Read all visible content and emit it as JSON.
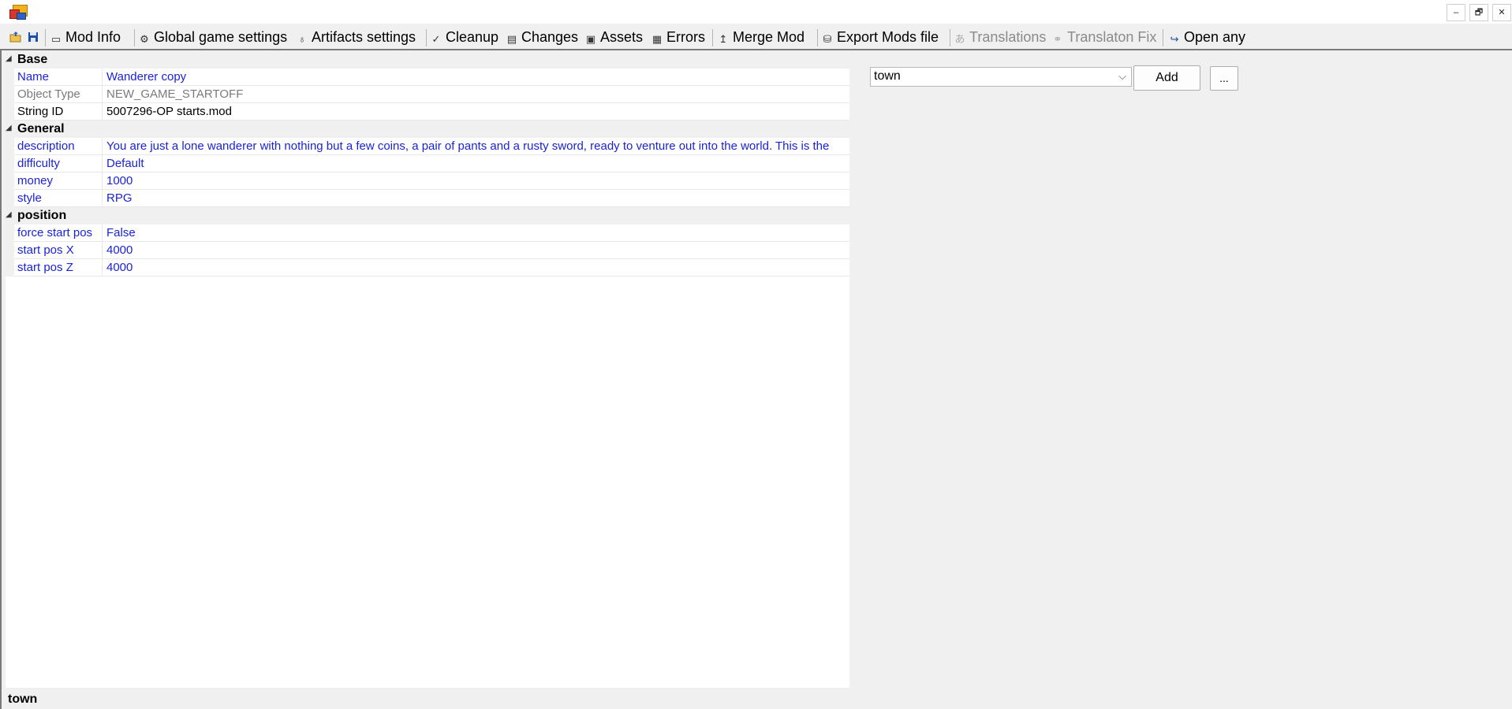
{
  "window": {
    "minimize": "–",
    "restore": "🗗",
    "close": "✕"
  },
  "toolbar": {
    "items": [
      {
        "label": "Mod Info",
        "icon": "mod-info-icon"
      },
      {
        "label": "Global game settings",
        "icon": "gear-icon"
      },
      {
        "label": "Artifacts settings",
        "icon": "artifact-icon"
      },
      {
        "label": "Cleanup",
        "icon": "broom-icon"
      },
      {
        "label": "Changes",
        "icon": "changes-icon"
      },
      {
        "label": "Assets",
        "icon": "assets-icon"
      },
      {
        "label": "Errors",
        "icon": "errors-icon"
      },
      {
        "label": "Merge Mod",
        "icon": "merge-icon"
      },
      {
        "label": "Export Mods file",
        "icon": "export-icon"
      },
      {
        "label": "Translations",
        "icon": "translations-icon",
        "disabled": true
      },
      {
        "label": "Translaton Fix",
        "icon": "translation-fix-icon",
        "disabled": true
      },
      {
        "label": "Open any",
        "icon": "open-arrow-icon"
      }
    ]
  },
  "grid": {
    "categories": [
      {
        "label": "Base",
        "rows": [
          {
            "name": "Name",
            "value": "Wanderer copy"
          },
          {
            "name": "Object Type",
            "value": "NEW_GAME_STARTOFF"
          },
          {
            "name": "String ID",
            "value": "5007296-OP starts.mod"
          }
        ]
      },
      {
        "label": "General",
        "rows": [
          {
            "name": "description",
            "value": "You are just a lone wanderer with nothing but a few coins, a pair of pants and a rusty sword, ready to venture out into the world.  This is the"
          },
          {
            "name": "difficulty",
            "value": "Default"
          },
          {
            "name": "money",
            "value": "1000"
          },
          {
            "name": "style",
            "value": "RPG"
          }
        ]
      },
      {
        "label": "position",
        "rows": [
          {
            "name": "force start pos",
            "value": "False"
          },
          {
            "name": "start pos X",
            "value": "4000"
          },
          {
            "name": "start pos Z",
            "value": "4000"
          }
        ]
      }
    ]
  },
  "side": {
    "combo_value": "town",
    "add_label": "Add",
    "more_label": "..."
  },
  "status": {
    "text": "town"
  },
  "colors": {
    "value_blue": "#1a23d6",
    "readonly_gray": "#7a7a7a"
  }
}
